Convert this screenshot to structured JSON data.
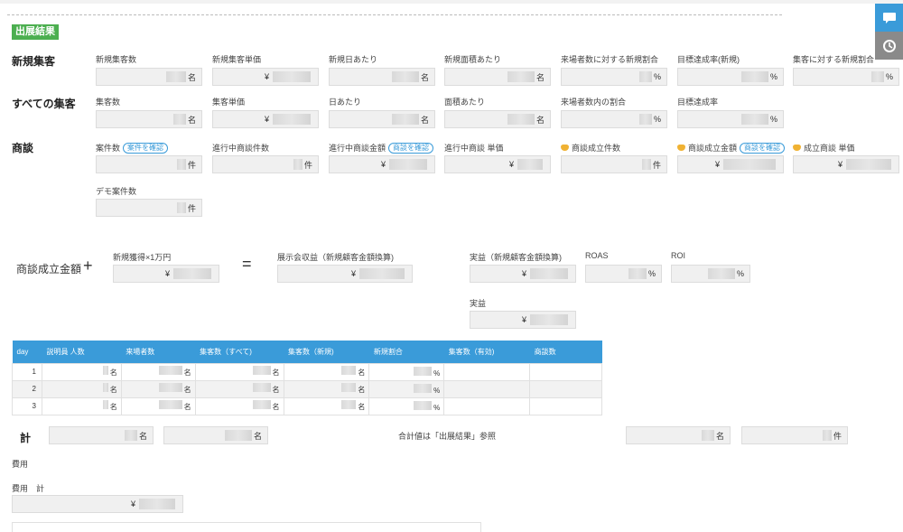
{
  "section_tag": "出展結果",
  "rows": {
    "new": "新規集客",
    "all": "すべての集客",
    "deal": "商談"
  },
  "new_fields": [
    {
      "label": "新規集客数",
      "unit": "名"
    },
    {
      "label": "新規集客単価",
      "prefix": "¥"
    },
    {
      "label": "新規日あたり",
      "unit": "名"
    },
    {
      "label": "新規面積あたり",
      "unit": "名"
    },
    {
      "label": "来場者数に対する新規割合",
      "unit": "%"
    },
    {
      "label": "目標達成率(新規)",
      "unit": "%"
    },
    {
      "label": "集客に対する新規割合",
      "unit": "%"
    }
  ],
  "all_fields": [
    {
      "label": "集客数",
      "unit": "名"
    },
    {
      "label": "集客単価",
      "prefix": "¥"
    },
    {
      "label": "日あたり",
      "unit": "名"
    },
    {
      "label": "面積あたり",
      "unit": "名"
    },
    {
      "label": "来場者数内の割合",
      "unit": "%"
    },
    {
      "label": "目標達成率",
      "unit": "%"
    }
  ],
  "deal_fields": [
    {
      "label": "案件数",
      "unit": "件",
      "button": "案件を確認"
    },
    {
      "label": "進行中商談件数",
      "unit": "件"
    },
    {
      "label": "進行中商談金額",
      "prefix": "¥",
      "button": "商談を確認"
    },
    {
      "label": "進行中商談 単価",
      "prefix": "¥"
    },
    {
      "label": "商談成立件数",
      "unit": "件"
    },
    {
      "label": "商談成立金額",
      "prefix": "¥",
      "button": "商談を確認"
    },
    {
      "label": "成立商談 単価",
      "prefix": "¥"
    }
  ],
  "demo": {
    "label": "デモ案件数",
    "unit": "件"
  },
  "calc": {
    "title": "商談成立金額",
    "plus": "+",
    "equals": "=",
    "new_acq_label": "新規獲得×1万円",
    "exhibit_label": "展示会収益（新規顧客金額換算)",
    "actual_conv_label": "実益（新規顧客金額換算)",
    "roas_label": "ROAS",
    "roi_label": "ROI",
    "actual_label": "実益",
    "yen": "¥",
    "percent": "%"
  },
  "table": {
    "headers": [
      "day",
      "説明員 人数",
      "来場者数",
      "集客数（すべて)",
      "集客数（新規)",
      "新規割合",
      "集客数（有効)",
      "商談数"
    ],
    "rows": [
      {
        "day": "1",
        "u1": "名",
        "u2": "名",
        "u3": "名",
        "u4": "名",
        "u5": "%"
      },
      {
        "day": "2",
        "u1": "名",
        "u2": "名",
        "u3": "名",
        "u4": "名",
        "u5": "%"
      },
      {
        "day": "3",
        "u1": "名",
        "u2": "名",
        "u3": "名",
        "u4": "名",
        "u5": "%"
      }
    ]
  },
  "total": {
    "label": "計",
    "unit_a": "名",
    "unit_b": "名",
    "note": "合計値は「出展結果」参照",
    "unit_c": "名",
    "unit_d": "件"
  },
  "cost": {
    "label": "費用",
    "total_label": "費用　計",
    "yen": "¥"
  },
  "colors": {
    "accent": "#3a9bd9",
    "tag": "#4caf50",
    "chat_button": "#3a9bd9",
    "history_button": "#888888"
  },
  "icons": [
    "chat-icon",
    "history-icon",
    "handshake-icon"
  ]
}
